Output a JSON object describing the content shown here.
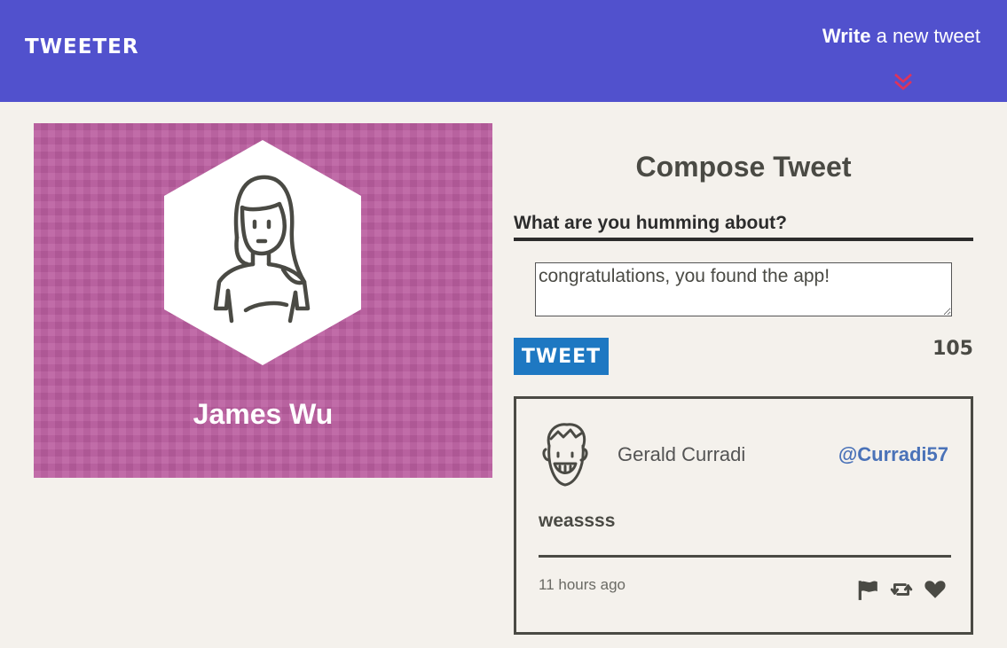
{
  "nav": {
    "brand": "TWEETER",
    "write_bold": "Write",
    "write_rest": " a new tweet",
    "chevron_color": "#e0335a",
    "background": "#5151cd"
  },
  "profile": {
    "name": "James Wu",
    "background": "#bb5ea0"
  },
  "compose": {
    "title": "Compose Tweet",
    "label": "What are you humming about?",
    "input_value": "congratulations, you found the app!",
    "button_label": "TWEET",
    "counter": "105",
    "button_color": "#1e78c2"
  },
  "tweet": {
    "author": "Gerald Curradi",
    "handle": "@Curradi57",
    "text": "weassss",
    "time": "11 hours ago",
    "actions": [
      "flag-icon",
      "retweet-icon",
      "heart-icon"
    ]
  }
}
